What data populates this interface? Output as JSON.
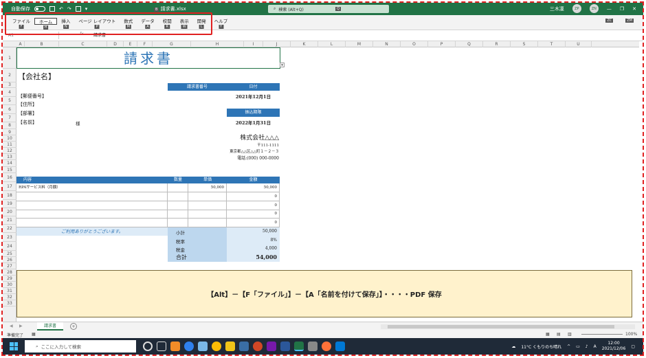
{
  "titlebar": {
    "autosave": "自動保存",
    "autosave_state": "オフ",
    "filename": "請求書.xlsx",
    "filename_prefix": "B",
    "search_placeholder": "検索 (Alt+Q)",
    "search_keytip": "Q",
    "user": "三木凜",
    "user_keytip": "ZP",
    "account_keytip": "ZN"
  },
  "ribbon": {
    "tabs": [
      {
        "label": "ファイル",
        "keytip": "F"
      },
      {
        "label": "ホーム",
        "keytip": "H"
      },
      {
        "label": "挿入",
        "keytip": "N"
      },
      {
        "label": "ページ レイアウト",
        "keytip": "P"
      },
      {
        "label": "数式",
        "keytip": "M"
      },
      {
        "label": "データ",
        "keytip": "A"
      },
      {
        "label": "校閲",
        "keytip": "R"
      },
      {
        "label": "表示",
        "keytip": "W"
      },
      {
        "label": "開発",
        "keytip": "L"
      },
      {
        "label": "ヘルプ",
        "keytip": "Y"
      }
    ],
    "right_keytips": [
      "ZC",
      "ZM"
    ]
  },
  "formula": {
    "namebox": "A1",
    "fx": "fx",
    "value": "請求書"
  },
  "columns": [
    "A",
    "B",
    "C",
    "D",
    "E",
    "F",
    "G",
    "H",
    "I",
    "J",
    "K",
    "L",
    "M",
    "N",
    "O",
    "P",
    "Q",
    "R",
    "S",
    "T",
    "U"
  ],
  "rows": [
    "1",
    "2",
    "3",
    "4",
    "5",
    "6",
    "7",
    "8",
    "9",
    "10",
    "11",
    "12",
    "13",
    "14",
    "15",
    "16",
    "17",
    "18",
    "19",
    "20",
    "21",
    "22",
    "23",
    "24",
    "25",
    "26",
    "27",
    "28",
    "29",
    "30",
    "31",
    "32",
    "33"
  ],
  "invoice": {
    "title": "請求書",
    "company": "【会社名】",
    "invoice_no_label": "請求書番号",
    "date_label": "日付",
    "date_value": "2021年12月1日",
    "postal_label": "【郵便番号】",
    "address_label": "【住所】",
    "dept_label": "【部署】",
    "name_label": "【名前】",
    "honorific": "様",
    "due_label": "振込期限",
    "due_value": "2022年1月31日",
    "issuer": "株式会社△△△",
    "issuer_postal": "〒111-1111",
    "issuer_address": "東京都△△区△△町１－２－３",
    "issuer_tel": "電話:(000) 000-0000",
    "table_headers": [
      "内容",
      "数量",
      "単価",
      "金額"
    ],
    "items": [
      {
        "desc": "RPAサービス料（月額）",
        "qty": "",
        "price": "50,000",
        "amount": "50,000"
      },
      {
        "desc": "",
        "qty": "",
        "price": "",
        "amount": "0"
      },
      {
        "desc": "",
        "qty": "",
        "price": "",
        "amount": "0"
      },
      {
        "desc": "",
        "qty": "",
        "price": "",
        "amount": "0"
      },
      {
        "desc": "",
        "qty": "",
        "price": "",
        "amount": "0"
      }
    ],
    "thanks": "ご利用ありがとうございます。",
    "subtotal_label": "小計",
    "subtotal_value": "50,000",
    "taxrate_label": "税率",
    "taxrate_value": "8%",
    "tax_label": "税金",
    "tax_value": "4,000",
    "total_label": "合計",
    "total_value": "54,000"
  },
  "note": "【Alt】－【F「ファイル」】－【A「名前を付けて保存」】・・・・PDF 保存",
  "sheet_tab": "請求書",
  "status": {
    "ready": "準備完了",
    "zoom": "100%"
  },
  "taskbar": {
    "search_placeholder": "ここに入力して検索",
    "weather": "11°C くもりのち晴れ",
    "ime": "A",
    "time": "12:00",
    "date": "2021/12/06"
  },
  "colors": {
    "excel_green": "#217346",
    "header_blue": "#2e75b6",
    "light_blue": "#bdd7ee",
    "note_yellow": "#fff2cc",
    "highlight_red": "#e02020"
  }
}
